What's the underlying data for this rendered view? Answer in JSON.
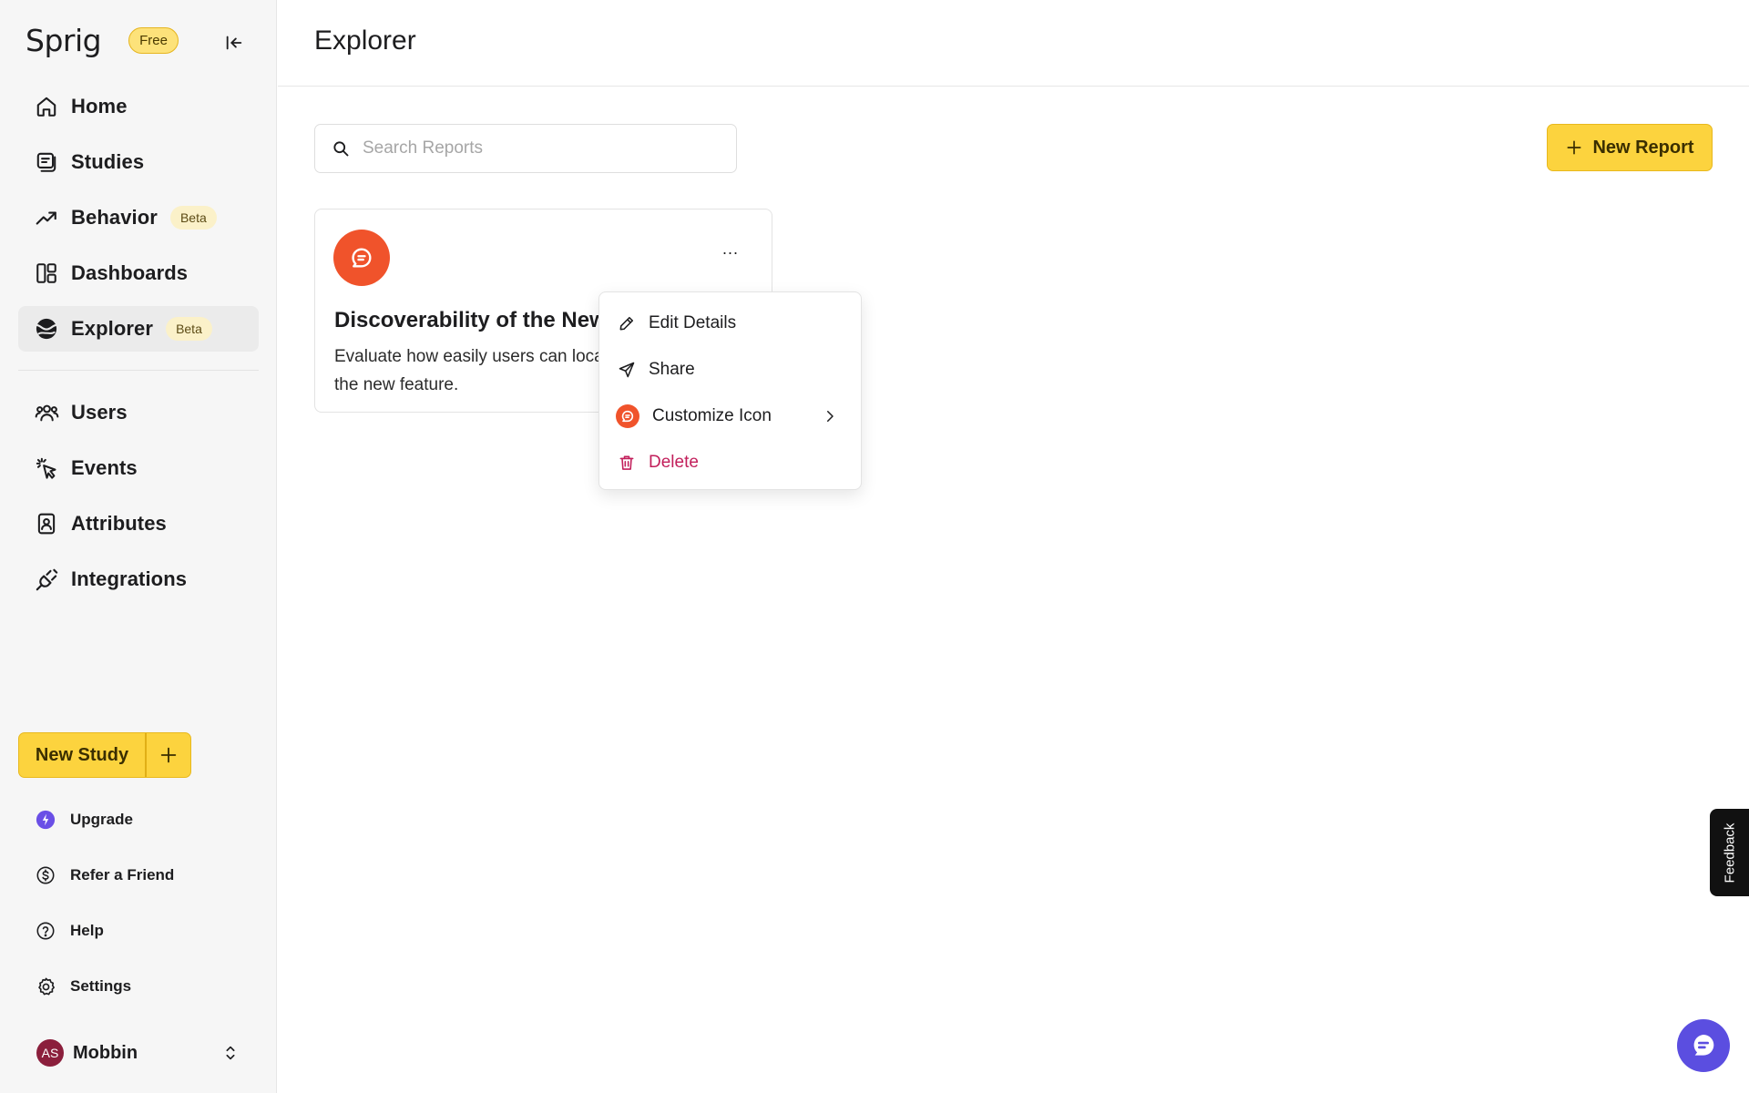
{
  "sidebar": {
    "logo": "Sprig",
    "plan_badge": "Free",
    "nav": [
      {
        "label": "Home",
        "icon": "home-icon"
      },
      {
        "label": "Studies",
        "icon": "studies-icon"
      },
      {
        "label": "Behavior",
        "icon": "trend-icon",
        "badge": "Beta"
      },
      {
        "label": "Dashboards",
        "icon": "dashboard-icon"
      },
      {
        "label": "Explorer",
        "icon": "explorer-icon",
        "badge": "Beta",
        "active": true
      },
      {
        "label": "Users",
        "icon": "users-icon"
      },
      {
        "label": "Events",
        "icon": "events-icon"
      },
      {
        "label": "Attributes",
        "icon": "attributes-icon"
      },
      {
        "label": "Integrations",
        "icon": "plug-icon"
      }
    ],
    "new_study_label": "New Study",
    "utilities": [
      {
        "label": "Upgrade",
        "icon": "upgrade-icon"
      },
      {
        "label": "Refer a Friend",
        "icon": "dollar-icon"
      },
      {
        "label": "Help",
        "icon": "help-icon"
      },
      {
        "label": "Settings",
        "icon": "gear-icon"
      }
    ],
    "user": {
      "initials": "AS",
      "name": "Mobbin"
    }
  },
  "main": {
    "title": "Explorer",
    "search_placeholder": "Search Reports",
    "new_report_label": "New Report",
    "report_card": {
      "title": "Discoverability of the New Feature",
      "description": "Evaluate how easily users can locate and engage with the new feature.",
      "more_label": "..."
    },
    "context_menu": [
      {
        "label": "Edit Details",
        "icon": "pencil-icon"
      },
      {
        "label": "Share",
        "icon": "send-icon"
      },
      {
        "label": "Customize Icon",
        "icon": "chat-bubble-icon",
        "submenu": true
      },
      {
        "label": "Delete",
        "icon": "trash-icon",
        "danger": true
      }
    ]
  },
  "feedback_label": "Feedback",
  "colors": {
    "accent_yellow": "#fcd33e",
    "report_icon": "#f0532b",
    "danger": "#c21f5b",
    "chat_fab": "#5b4ee0"
  }
}
